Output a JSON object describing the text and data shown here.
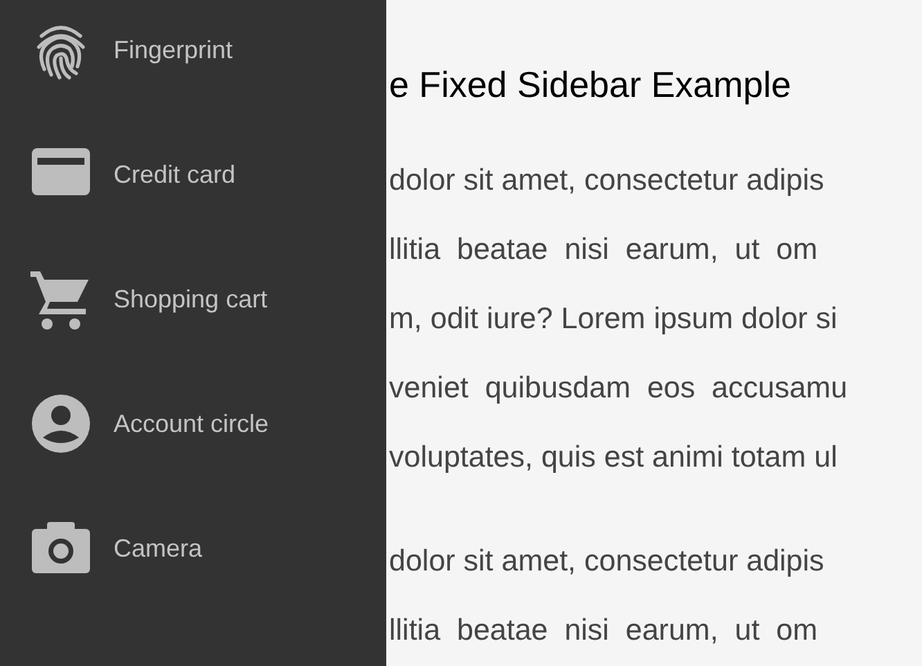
{
  "sidebar": {
    "items": [
      {
        "label": "Fingerprint"
      },
      {
        "label": "Credit card"
      },
      {
        "label": "Shopping cart"
      },
      {
        "label": "Account circle"
      },
      {
        "label": "Camera"
      }
    ]
  },
  "main": {
    "heading": "e Fixed Sidebar Example",
    "paragraphs": [
      [
        "dolor sit amet, consectetur adipis",
        "llitia  beatae  nisi  earum,  ut  om",
        "m, odit iure? Lorem ipsum dolor si",
        "veniet  quibusdam  eos  accusamu",
        "voluptates, quis est animi totam ul"
      ],
      [
        "dolor sit amet, consectetur adipis",
        "llitia  beatae  nisi  earum,  ut  om"
      ]
    ]
  }
}
